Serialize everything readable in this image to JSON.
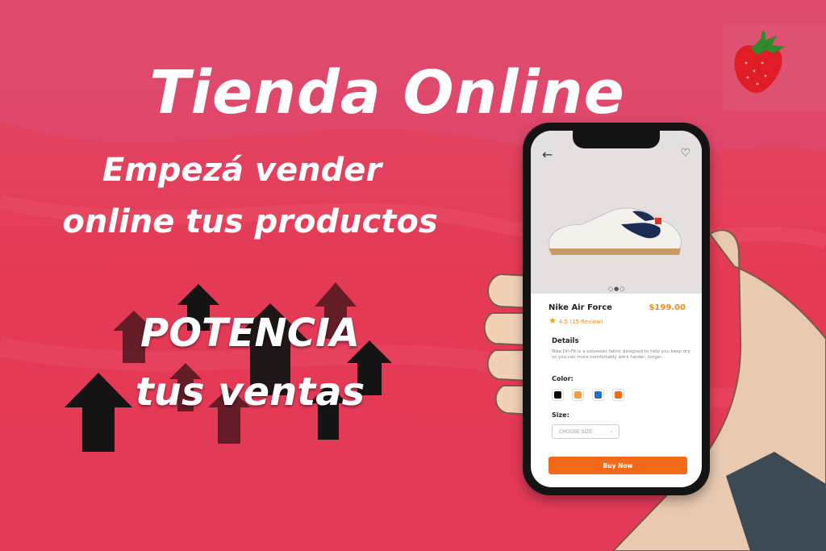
{
  "banner": {
    "title": "Tienda Online",
    "subtitle_line1": "Empezá  vender",
    "subtitle_line2": "online tus productos",
    "tagline_line1": "POTENCIA",
    "tagline_line2": "tus ventas"
  },
  "colors": {
    "background": "#e2405e",
    "accent_orange": "#f46a1b",
    "price_orange": "#f08a1c"
  },
  "product": {
    "back_icon": "arrow-left-icon",
    "favorite_icon": "heart-icon",
    "name": "Nike Air Force",
    "price": "$199.00",
    "rating_text": "4.5 (15 Review)",
    "details_title": "Details",
    "details_text": "Nike Dri-Fit is a polyester  fabric designed to help you keep dry so you can more comfortably work harder, longer.",
    "color_title": "Color:",
    "colors": [
      "#000000",
      "#f0a040",
      "#1e6fd9",
      "#f46a1b"
    ],
    "size_title": "Size:",
    "size_placeholder": "CHOOSE SIZE",
    "buy_label": "Buy Now"
  }
}
